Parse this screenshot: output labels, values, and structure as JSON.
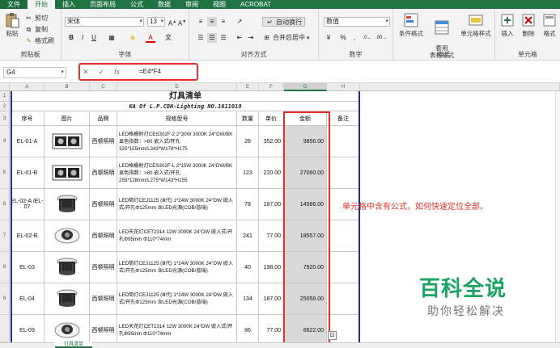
{
  "ribbon": {
    "tabs": [
      "文件",
      "开始",
      "插入",
      "页面布局",
      "公式",
      "数据",
      "审阅",
      "视图",
      "ACROBAT"
    ],
    "clipboard": {
      "paste": "粘贴",
      "cut": "剪切",
      "copy": "复制",
      "format_painter": "格式刷",
      "label": "剪贴板"
    },
    "font": {
      "name": "宋体",
      "size": "13",
      "label": "字体"
    },
    "alignment": {
      "wrap": "自动换行",
      "merge": "合并后居中",
      "label": "对齐方式"
    },
    "number": {
      "format": "数值",
      "label": "数字"
    },
    "styles": {
      "conditional": "条件格式",
      "table": "套用\n表格格式",
      "cell": "单元格样式",
      "label": "样式"
    },
    "cells": {
      "insert": "插入",
      "delete": "删除",
      "format": "格式",
      "label": "单元格"
    }
  },
  "formula_bar": {
    "name_box": "G4",
    "fx": "fx",
    "formula": "=E4*F4"
  },
  "columns": [
    "A",
    "B",
    "C",
    "D",
    "E",
    "F",
    "G",
    "H"
  ],
  "rows": [
    "1",
    "2",
    "3",
    "4",
    "5",
    "6",
    "7",
    "8",
    "9"
  ],
  "sheet": {
    "title": "灯具清单",
    "subtitle": "KA Of L.P.CDN-Lighting NO.1611019",
    "headers": [
      "序号",
      "图片",
      "品牌",
      "规格型号",
      "数量",
      "单价",
      "金额",
      "备注"
    ],
    "items": [
      {
        "code": "EL-01-A",
        "brand": "西顿照明",
        "spec": "LED格栅射灯CES302F-2 2*30W 3000K 24°DW/BK 显色指数：>80 嵌入式/开孔325*155mm/L343*W178*H175",
        "qty": "28",
        "price": "352.00",
        "amount": "9856.00"
      },
      {
        "code": "EL-01-B",
        "brand": "西顿照明",
        "spec": "LED格栅射灯CES302F-L 2*15W 3000K 24°DW/BK 显色指数：>80 嵌入式/开孔255*128mm/L275*W143*H155",
        "qty": "123",
        "price": "220.00",
        "amount": "27060.00"
      },
      {
        "code": "EL-02-A /EL-07",
        "brand": "西顿照明",
        "spec": "LED筒灯CEJ1125 (Ⅲ代) 1*24W 3000K 24°DW 嵌入式/开孔Φ125mm 含LED光源(COB/普瑞)",
        "qty": "78",
        "price": "187.00",
        "amount": "14586.00"
      },
      {
        "code": "EL-02-B",
        "brand": "西顿照明",
        "spec": "LED天花灯CET2314 12W 3000K 24°DW 嵌入式/开孔Φ95mm Φ110*74mm",
        "qty": "241",
        "price": "77.00",
        "amount": "18557.00"
      },
      {
        "code": "EL-03",
        "brand": "西顿照明",
        "spec": "LED筒灯CEJ1125 (Ⅲ代) 1*24W 3000K 24°DW 嵌入式/开孔Φ125mm 含LED光源(COB/普瑞)",
        "qty": "40",
        "price": "198.00",
        "amount": "7920.00"
      },
      {
        "code": "EL-04",
        "brand": "西顿照明",
        "spec": "LED筒灯CEJ1125 (Ⅲ代) 1*24W 3000K 24°DW 嵌入式/开孔Φ125mm 含LED光源(COB/普瑞)",
        "qty": "134",
        "price": "187.00",
        "amount": "25058.00"
      },
      {
        "code": "EL-09",
        "brand": "西顿照明",
        "spec": "LED天花灯CET2314 12W 3000K 24°DW 嵌入式/开孔Φ95mm Φ110*74mm",
        "qty": "86",
        "price": "77.00",
        "amount": "6622.00"
      }
    ]
  },
  "annotation": "单元格中含有公式，如何快速定位全部。",
  "watermark": {
    "title": "百科全说",
    "subtitle": "助你轻松解决"
  },
  "sheet_tab": "灯具清单",
  "colors": {
    "excel_green": "#217346",
    "highlight_red": "#e0312a",
    "border_blue": "#1b2ca0",
    "watermark_green": "#19a463"
  }
}
